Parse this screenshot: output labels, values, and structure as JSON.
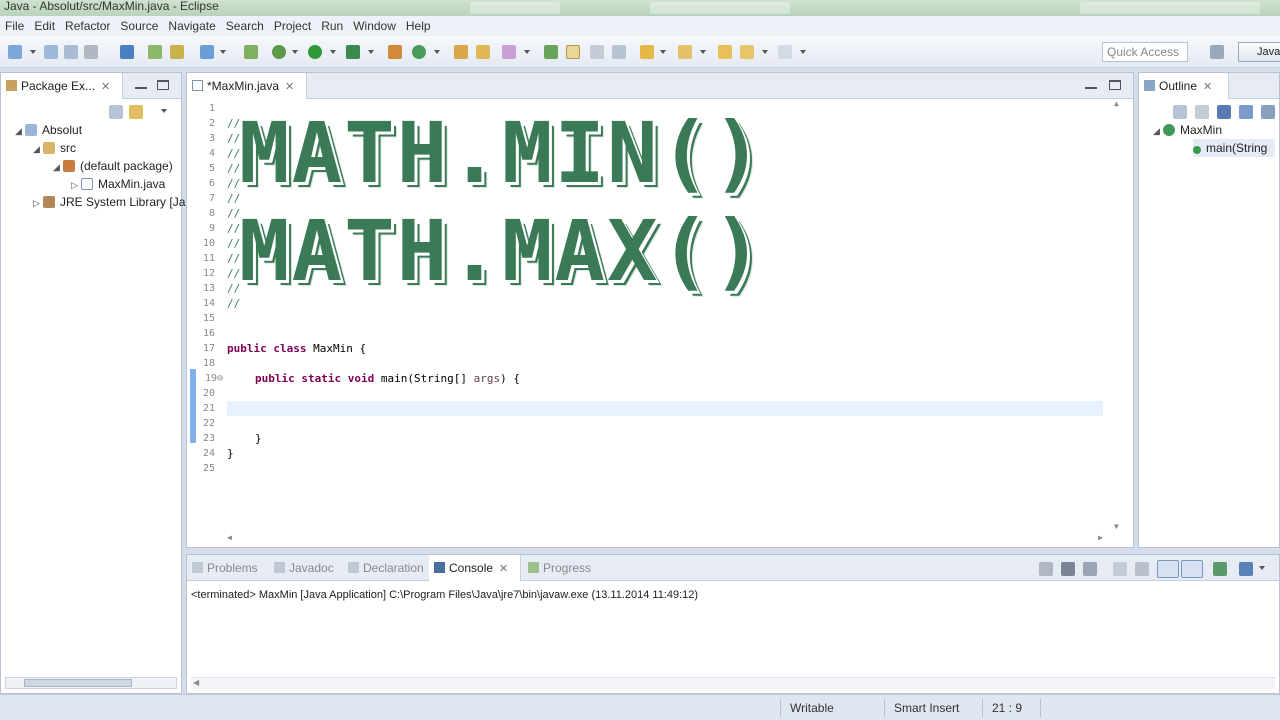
{
  "window": {
    "title": "Java - Absolut/src/MaxMin.java - Eclipse"
  },
  "menu": [
    "File",
    "Edit",
    "Refactor",
    "Source",
    "Navigate",
    "Search",
    "Project",
    "Run",
    "Window",
    "Help"
  ],
  "toolbar": {
    "quick_access_placeholder": "Quick Access",
    "perspective_label": "Java"
  },
  "package_explorer": {
    "tab_label": "Package Ex...",
    "tree": [
      {
        "label": "Absolut",
        "level": 0,
        "icon": "project-icon"
      },
      {
        "label": "src",
        "level": 1,
        "icon": "source-folder-icon"
      },
      {
        "label": "(default package)",
        "level": 2,
        "icon": "package-icon"
      },
      {
        "label": "MaxMin.java",
        "level": 3,
        "icon": "java-file-icon"
      },
      {
        "label": "JRE System Library [Ja",
        "level": 1,
        "icon": "library-icon"
      }
    ]
  },
  "editor": {
    "tab_label": "*MaxMin.java",
    "line_numbers": [
      "1",
      "2",
      "3",
      "4",
      "5",
      "6",
      "7",
      "8",
      "9",
      "10",
      "11",
      "12",
      "13",
      "14",
      "15",
      "16",
      "17",
      "18",
      "19⊖",
      "20",
      "21",
      "22",
      "23",
      "24",
      "25"
    ],
    "comment_marker": "//",
    "banner_lines": [
      "MATH.MIN()",
      "MATH.MAX()"
    ],
    "code": {
      "line17_kw1": "public",
      "line17_kw2": "class",
      "line17_rest": "MaxMin {",
      "line19_kw1": "public",
      "line19_kw2": "static",
      "line19_kw3": "void",
      "line19_rest1": "main(String[]",
      "line19_param": "args",
      "line19_rest2": ") {",
      "line23": "}",
      "line24": "}"
    }
  },
  "outline": {
    "tab_label": "Outline",
    "items": [
      {
        "label": "MaxMin",
        "icon": "class-icon"
      },
      {
        "label": "main(String",
        "icon": "method-icon"
      }
    ]
  },
  "bottom_panel": {
    "tabs": [
      "Problems",
      "Javadoc",
      "Declaration",
      "Console",
      "Progress"
    ],
    "active_tab": "Console",
    "console_line": "<terminated> MaxMin [Java Application] C:\\Program Files\\Java\\jre7\\bin\\javaw.exe (13.11.2014 11:49:12)"
  },
  "status_bar": {
    "writable": "Writable",
    "insert_mode": "Smart Insert",
    "position": "21 : 9"
  },
  "colors": {
    "comment": "#3f7f5f",
    "keyword": "#7f0055",
    "banner": "#3b7a57",
    "current_line": "#e8f2fe"
  }
}
